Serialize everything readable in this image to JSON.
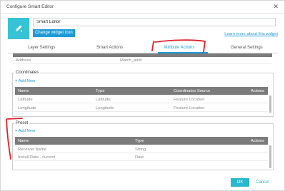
{
  "window": {
    "title": "Configure Smart Editor",
    "close_glyph": "✕"
  },
  "widget": {
    "name": "Smart Editor",
    "change_icon_label": "Change widget icon",
    "learn_more": "Learn more about this widget",
    "icon": "pencil-icon",
    "icon_color": "#36c3d6"
  },
  "tabs": [
    {
      "label": "Layer Settings",
      "active": false
    },
    {
      "label": "Smart Actions",
      "active": false
    },
    {
      "label": "Attribute Actions",
      "active": true
    },
    {
      "label": "General Settings",
      "active": false
    }
  ],
  "top_row": {
    "name": "Address",
    "value": "Match_addr"
  },
  "coordinates": {
    "legend": "Coordinates",
    "add_new": "Add New",
    "headers": [
      "Name",
      "Type",
      "Coordinates Source",
      "Actions"
    ],
    "rows": [
      {
        "name": "Latitude",
        "type": "Latitude",
        "source": "Feature Location"
      },
      {
        "name": "Longitude",
        "type": "Longitude",
        "source": "Feature Location"
      }
    ]
  },
  "preset": {
    "legend": "Preset",
    "add_new": "Add New",
    "headers": [
      "Name",
      "Type",
      "Actions"
    ],
    "rows": [
      {
        "name": "Receiver Name",
        "type": "String"
      },
      {
        "name": "Install Date - current",
        "type": "Date"
      }
    ]
  },
  "footer": {
    "ok": "OK",
    "cancel": "Cancel"
  },
  "colors": {
    "accent": "#1e9bd7",
    "ok_button": "#29b8d0",
    "header_gray": "#7b7b7b",
    "annotation_red": "#e0202a"
  }
}
